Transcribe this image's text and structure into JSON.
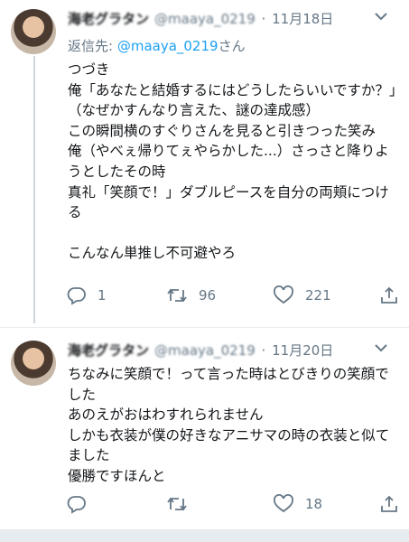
{
  "tweets": [
    {
      "name": "海老グラタン",
      "handle": "@maaya_0219",
      "separator": "·",
      "date": "11月18日",
      "reply_prefix": "返信先: ",
      "reply_to": "@maaya_0219",
      "reply_suffix": "さん",
      "body": "つづき\n俺「あなたと結婚するにはどうしたらいいですか？」（なぜかすんなり言えた、謎の達成感）\nこの瞬間横のすぐりさんを見ると引きつった笑み\n俺（やべぇ帰りてぇやらかした...）さっさと降りようとしたその時\n真礼「笑顔で！」ダブルピースを自分の両頬につける\n\nこんなん単推し不可避やろ",
      "replies": "1",
      "retweets": "96",
      "likes": "221"
    },
    {
      "name": "海老グラタン",
      "handle": "@maaya_0219",
      "separator": "·",
      "date": "11月20日",
      "body": "ちなみに笑顔で！って言った時はとびきりの笑顔でした\nあのえがおはわすれられません\nしかも衣装が僕の好きなアニサマの時の衣装と似てました\n優勝ですほんと",
      "replies": "",
      "retweets": "",
      "likes": "18"
    }
  ],
  "icons": {
    "reply": "reply-icon",
    "retweet": "retweet-icon",
    "like": "heart-icon",
    "share": "share-icon",
    "caret": "chevron-down-icon"
  },
  "colors": {
    "text": "#14171a",
    "secondary": "#657786",
    "link": "#1da1f2",
    "divider": "#e6ecf0"
  }
}
